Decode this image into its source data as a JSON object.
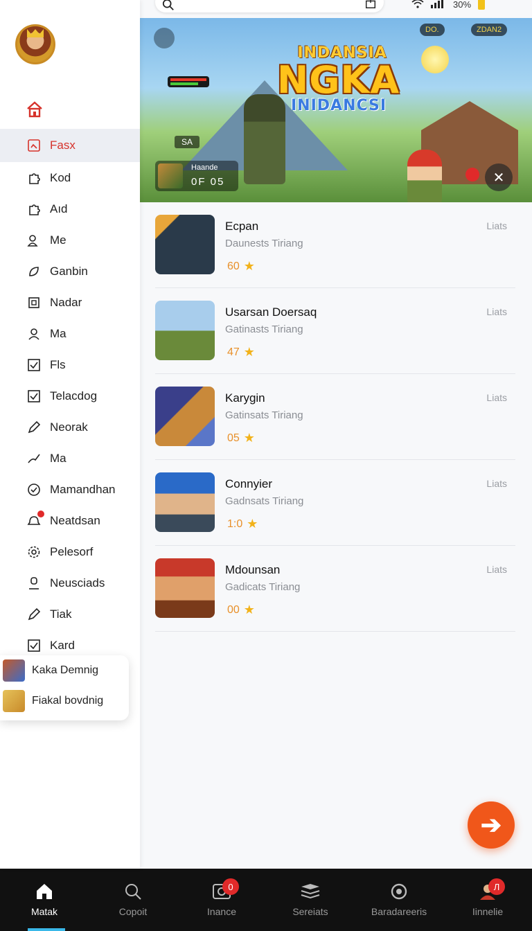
{
  "status": {
    "battery": "30%"
  },
  "banner": {
    "title_top": "INDANSIA",
    "title_main": "NGKA",
    "title_bottom": "INIDANCSI",
    "tag": "SA",
    "timer_label": "Haande",
    "timer_value": "0F  05",
    "chip1": "DO.",
    "chip2": "ZDAN2"
  },
  "sidebar": {
    "items": [
      {
        "label": "Fasx",
        "icon": "frame-icon",
        "active": true
      },
      {
        "label": "Kod",
        "icon": "puzzle-icon"
      },
      {
        "label": "Aıd",
        "icon": "puzzle-icon"
      },
      {
        "label": "Me",
        "icon": "people-icon"
      },
      {
        "label": "Ganbin",
        "icon": "leaf-icon"
      },
      {
        "label": "Nadar",
        "icon": "square-icon"
      },
      {
        "label": "Ma",
        "icon": "person-icon"
      },
      {
        "label": "Fls",
        "icon": "check-square-icon"
      },
      {
        "label": "Telacdog",
        "icon": "check-square-icon"
      },
      {
        "label": "Neorak",
        "icon": "pen-icon"
      },
      {
        "label": "Ma",
        "icon": "brush-icon"
      },
      {
        "label": "Mamandhan",
        "icon": "check-circle-icon"
      },
      {
        "label": "Neatdsan",
        "icon": "notification-icon",
        "badge": true
      },
      {
        "label": "Pelesorf",
        "icon": "gear-icon"
      },
      {
        "label": "Neusciads",
        "icon": "user-icon"
      },
      {
        "label": "Tiak",
        "icon": "pen-icon"
      },
      {
        "label": "Kard",
        "icon": "check-square-icon"
      }
    ]
  },
  "popup": {
    "items": [
      {
        "label": "Kaka Demnig"
      },
      {
        "label": "Fiakal bovdnig"
      }
    ]
  },
  "list": {
    "rows": [
      {
        "name": "Ecpan",
        "sub": "Daunests  Tiriang",
        "rating": "60",
        "meta": "Liats"
      },
      {
        "name": "Usarsan Doersaq",
        "sub": "Gatinasts  Tiriang",
        "rating": "47",
        "meta": "Liats"
      },
      {
        "name": "Karygin",
        "sub": "Gatinsats  Tiriang",
        "rating": "05",
        "meta": "Liats"
      },
      {
        "name": "Connyier",
        "sub": "Gadnsats  Tiriang",
        "rating": "1:0",
        "meta": "Liats"
      },
      {
        "name": "Mdounsan",
        "sub": "Gadicats  Tiriang",
        "rating": "00",
        "meta": "Liats"
      }
    ]
  },
  "bottom_nav": {
    "tabs": [
      {
        "label": "Matak",
        "icon": "home-icon",
        "active": true
      },
      {
        "label": "Copoit",
        "icon": "search-icon"
      },
      {
        "label": "Inance",
        "icon": "camera-icon",
        "badge": "0"
      },
      {
        "label": "Sereiats",
        "icon": "stack-icon"
      },
      {
        "label": "Baradareeris",
        "icon": "target-icon"
      },
      {
        "label": "Iinnelie",
        "icon": "profile-icon",
        "badge": "Л"
      }
    ]
  },
  "colors": {
    "accent": "#d6322b",
    "fab": "#f0571a",
    "rating": "#e8902a",
    "star": "#f2b21a"
  }
}
